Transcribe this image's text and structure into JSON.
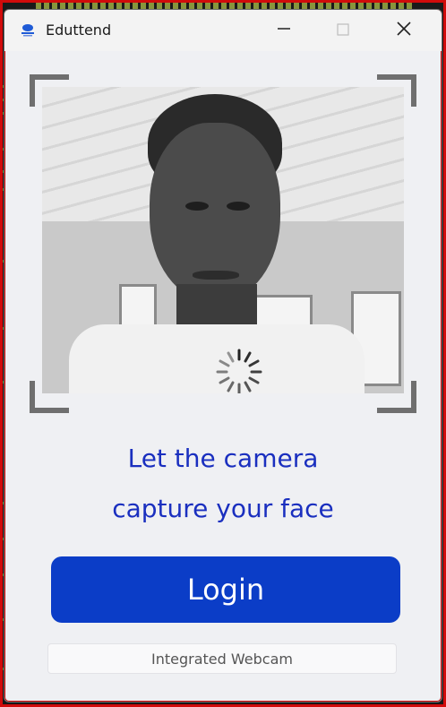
{
  "window": {
    "title": "Eduttend",
    "minimize_icon": "minimize-icon",
    "maximize_icon": "maximize-icon",
    "close_icon": "close-icon"
  },
  "camera": {
    "loading_icon": "spinner-icon"
  },
  "prompt": {
    "line1": "Let the camera",
    "line2": "capture your face"
  },
  "actions": {
    "login_label": "Login"
  },
  "camera_select": {
    "value": "Integrated Webcam"
  },
  "colors": {
    "accent": "#0b3dc7",
    "prompt_text": "#1a2fbf",
    "window_bg": "#eff0f3",
    "frame_border": "#d10b0b"
  }
}
